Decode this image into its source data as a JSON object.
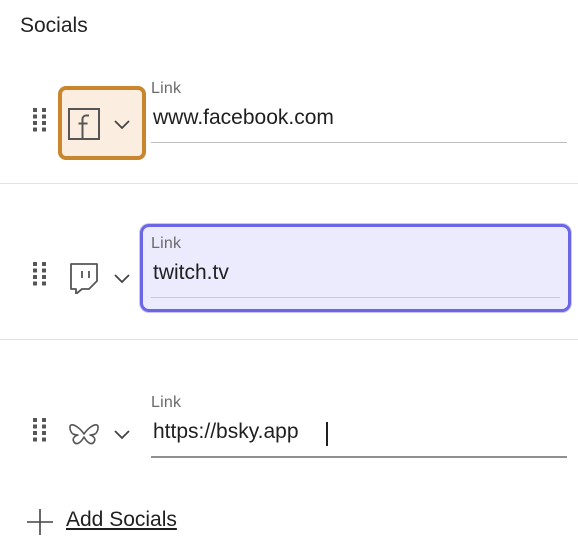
{
  "section": {
    "title": "Socials"
  },
  "socials": [
    {
      "icon": "facebook-icon",
      "label": "Link",
      "value": "www.facebook.com"
    },
    {
      "icon": "twitch-icon",
      "label": "Link",
      "value": "twitch.tv"
    },
    {
      "icon": "bluesky-butterfly-icon",
      "label": "Link",
      "value": "https://bsky.app"
    }
  ],
  "add_button": {
    "label": "Add Socials",
    "icon": "plus-icon"
  },
  "colors": {
    "icon_select_focus_border": "#c9862d",
    "icon_select_focus_bg": "#fbeee0",
    "field_focus_border": "#6b66e6",
    "field_focus_bg": "#ecebfd"
  }
}
